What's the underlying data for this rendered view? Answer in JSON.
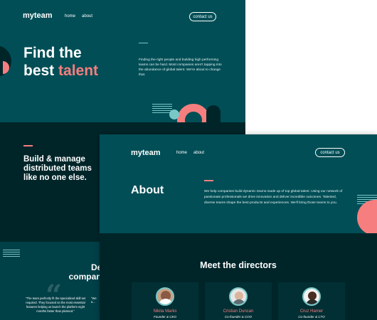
{
  "home": {
    "logo": "myteam",
    "nav": [
      "home",
      "about"
    ],
    "contact_label": "contact us",
    "hero_title_1": "Find the",
    "hero_title_2a": "best ",
    "hero_title_2b": "talent",
    "hero_body": "Finding the right people and building high performing teams can be hard. Most companies aren't tapping into the abundance of global talent. We're about to change that.",
    "build_title": "Build & manage distributed teams like no one else.",
    "delivering_title_1": "Delivering",
    "delivering_title_2": "companies. Sor",
    "quote_text": "\"The team perfectly fit the specialized skill set required. They focused on the most essential features helping us launch the platform eight months faster than planned.\"",
    "quote_partial": "\"We a...",
    "colors": {
      "accent": "#f67e7e",
      "teal": "#014e56",
      "dark": "#002529",
      "cyan": "#79c8c7"
    }
  },
  "about": {
    "logo": "myteam",
    "nav": [
      "home",
      "about"
    ],
    "contact_label": "contact us",
    "title": "About",
    "body": "We help companies build dynamic teams made up of top global talent. Using our network of passionate professionals we drive innovation and deliver incredible outcomes. Talented, diverse teams shape the best products and experiences. We'll bring those teams to you.",
    "directors_title": "Meet the directors",
    "directors": [
      {
        "name": "Nikita Marks",
        "role": "Founder & CEO"
      },
      {
        "name": "Cristian Duncan",
        "role": "Co-founder & COO"
      },
      {
        "name": "Cruz Hamer",
        "role": "Co-founder & CTO"
      }
    ]
  }
}
